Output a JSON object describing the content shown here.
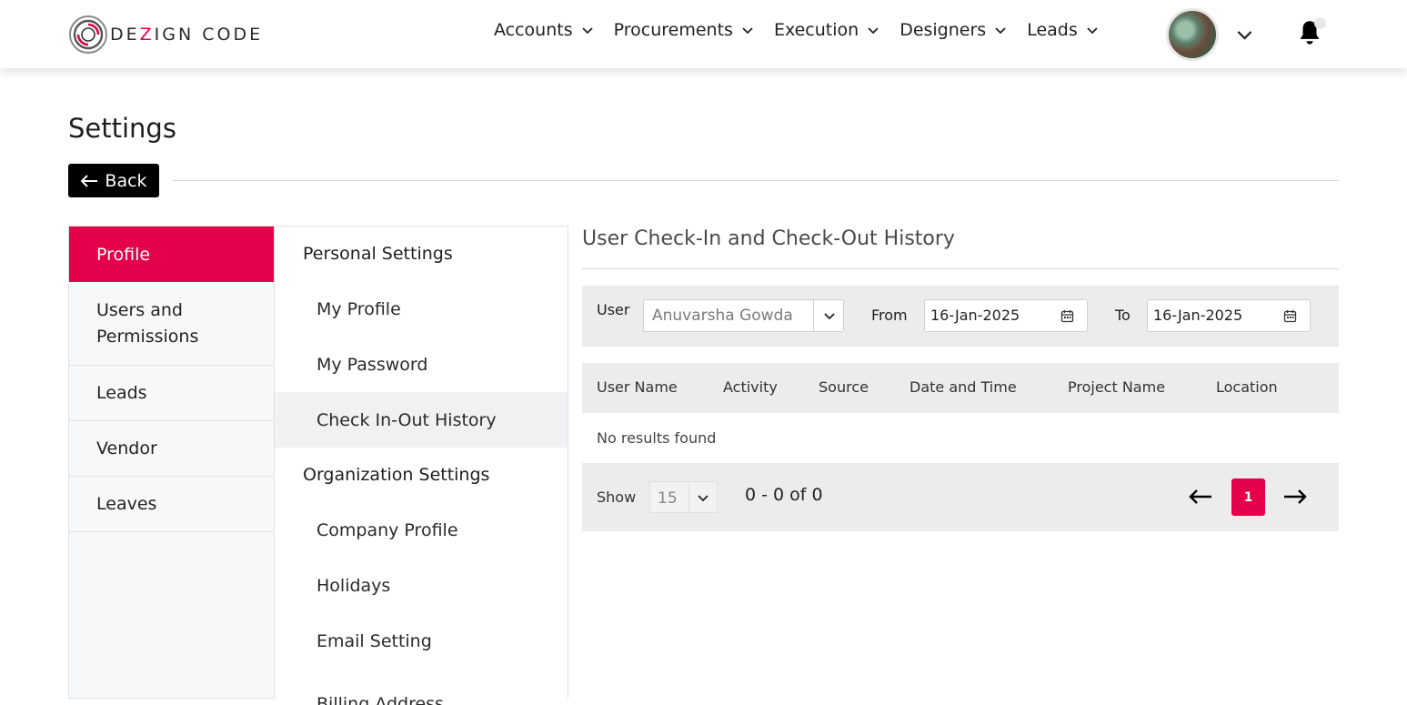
{
  "brand": {
    "logo_text_start": "DE",
    "logo_text_accent": "Z",
    "logo_text_end": "IGN CODE",
    "accent_color": "#e4004a"
  },
  "nav": {
    "items": [
      {
        "label": "Accounts",
        "icon": "chevron-down-icon"
      },
      {
        "label": "Procurements",
        "icon": "chevron-down-icon"
      },
      {
        "label": "Execution",
        "icon": "chevron-down-icon"
      },
      {
        "label": "Designers",
        "icon": "chevron-down-icon"
      },
      {
        "label": "Leads",
        "icon": "chevron-down-icon"
      }
    ],
    "avatar_icon": "user-avatar",
    "notification_icon": "bell-icon"
  },
  "page": {
    "title": "Settings",
    "back_label": "Back"
  },
  "primary_menu": {
    "items": [
      {
        "label": "Profile",
        "active": true
      },
      {
        "label": "Users and Permissions",
        "active": false
      },
      {
        "label": "Leads",
        "active": false
      },
      {
        "label": "Vendor",
        "active": false
      },
      {
        "label": "Leaves",
        "active": false
      }
    ]
  },
  "secondary_menu": {
    "personal_heading": "Personal Settings",
    "personal_items": [
      "My Profile",
      "My Password",
      "Check In-Out History"
    ],
    "active_item": "Check In-Out History",
    "org_heading": "Organization Settings",
    "org_items": [
      "Company Profile",
      "Holidays",
      "Email Setting",
      "Billing Address"
    ]
  },
  "content": {
    "title": "User Check-In and Check-Out History",
    "filters": {
      "user_label": "User",
      "user_value": "Anuvarsha Gowda",
      "from_label": "From",
      "from_value": "16-Jan-2025",
      "to_label": "To",
      "to_value": "16-Jan-2025"
    },
    "table": {
      "columns": [
        "User Name",
        "Activity",
        "Source",
        "Date and Time",
        "Project Name",
        "Location"
      ],
      "rows": [],
      "empty_text": "No results found"
    },
    "pagination": {
      "show_label": "Show",
      "page_size": "15",
      "range_text": "0 - 0 of 0",
      "current_page": "1"
    }
  }
}
